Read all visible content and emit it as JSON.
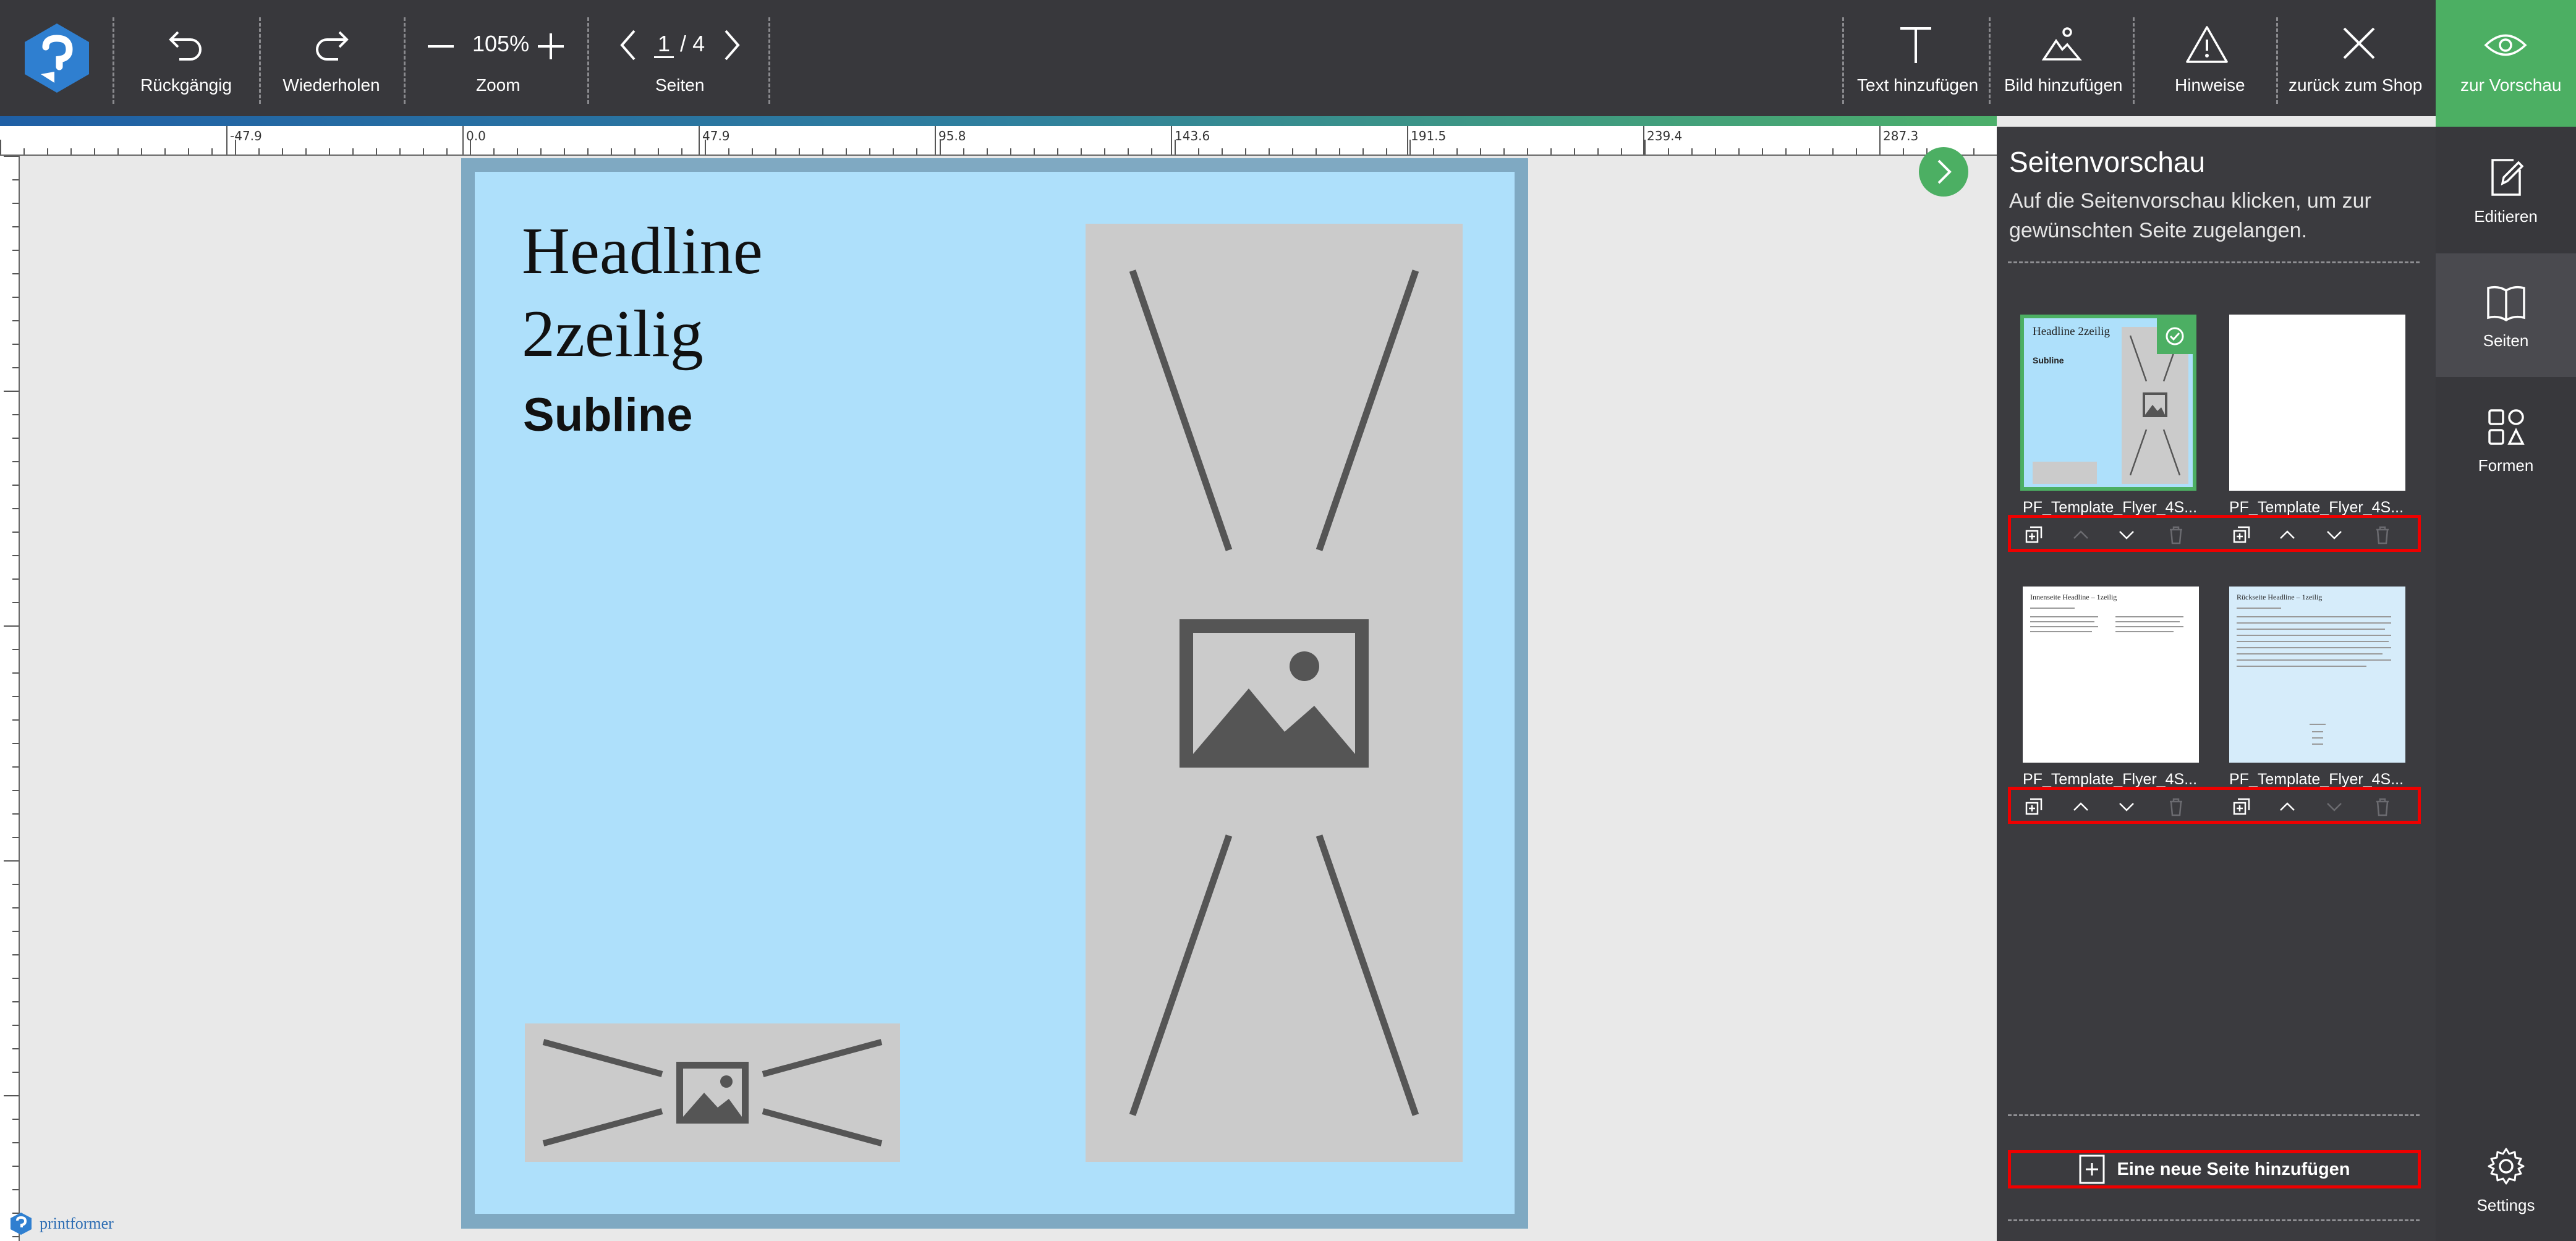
{
  "toolbar": {
    "undo": "Rückgängig",
    "redo": "Wiederholen",
    "zoom_label": "Zoom",
    "zoom_value": "105%",
    "pages_label": "Seiten",
    "current_page": "1",
    "page_sep": "/",
    "total_pages": "4",
    "add_text": "Text hinzufügen",
    "add_image": "Bild hinzufügen",
    "hints": "Hinweise",
    "back_to_shop": "zurück zum Shop",
    "preview": "zur Vorschau"
  },
  "ruler": {
    "labels": [
      "-47.9",
      "0.0",
      "47.9",
      "95.8",
      "143.6",
      "191.5",
      "239.4",
      "287.3"
    ]
  },
  "document": {
    "headline": "Headline\n2zeilig",
    "subline": "Subline"
  },
  "panel": {
    "title": "Seitenvorschau",
    "description": "Auf die Seitenvorschau klicken, um zur gewünschten Seite zugelangen.",
    "pages": [
      {
        "name": "PF_Template_Flyer_4S..."
      },
      {
        "name": "PF_Template_Flyer_4S..."
      },
      {
        "name": "PF_Template_Flyer_4S..."
      },
      {
        "name": "PF_Template_Flyer_4S..."
      }
    ],
    "thumb3_title": "Innenseite Headline – 1zeilig",
    "thumb4_title": "Rückseite Headline – 1zeilig",
    "add_page": "Eine neue Seite hinzufügen"
  },
  "sidebar": {
    "edit": "Editieren",
    "pages": "Seiten",
    "shapes": "Formen",
    "settings": "Settings"
  },
  "brand": {
    "name": "printformer"
  },
  "colors": {
    "toolbar_bg": "#38383c",
    "accent_green": "#4caf63",
    "doc_bg": "#aee0fb",
    "placeholder_gray": "#cbcbcb",
    "highlight_red": "#ee0000"
  }
}
